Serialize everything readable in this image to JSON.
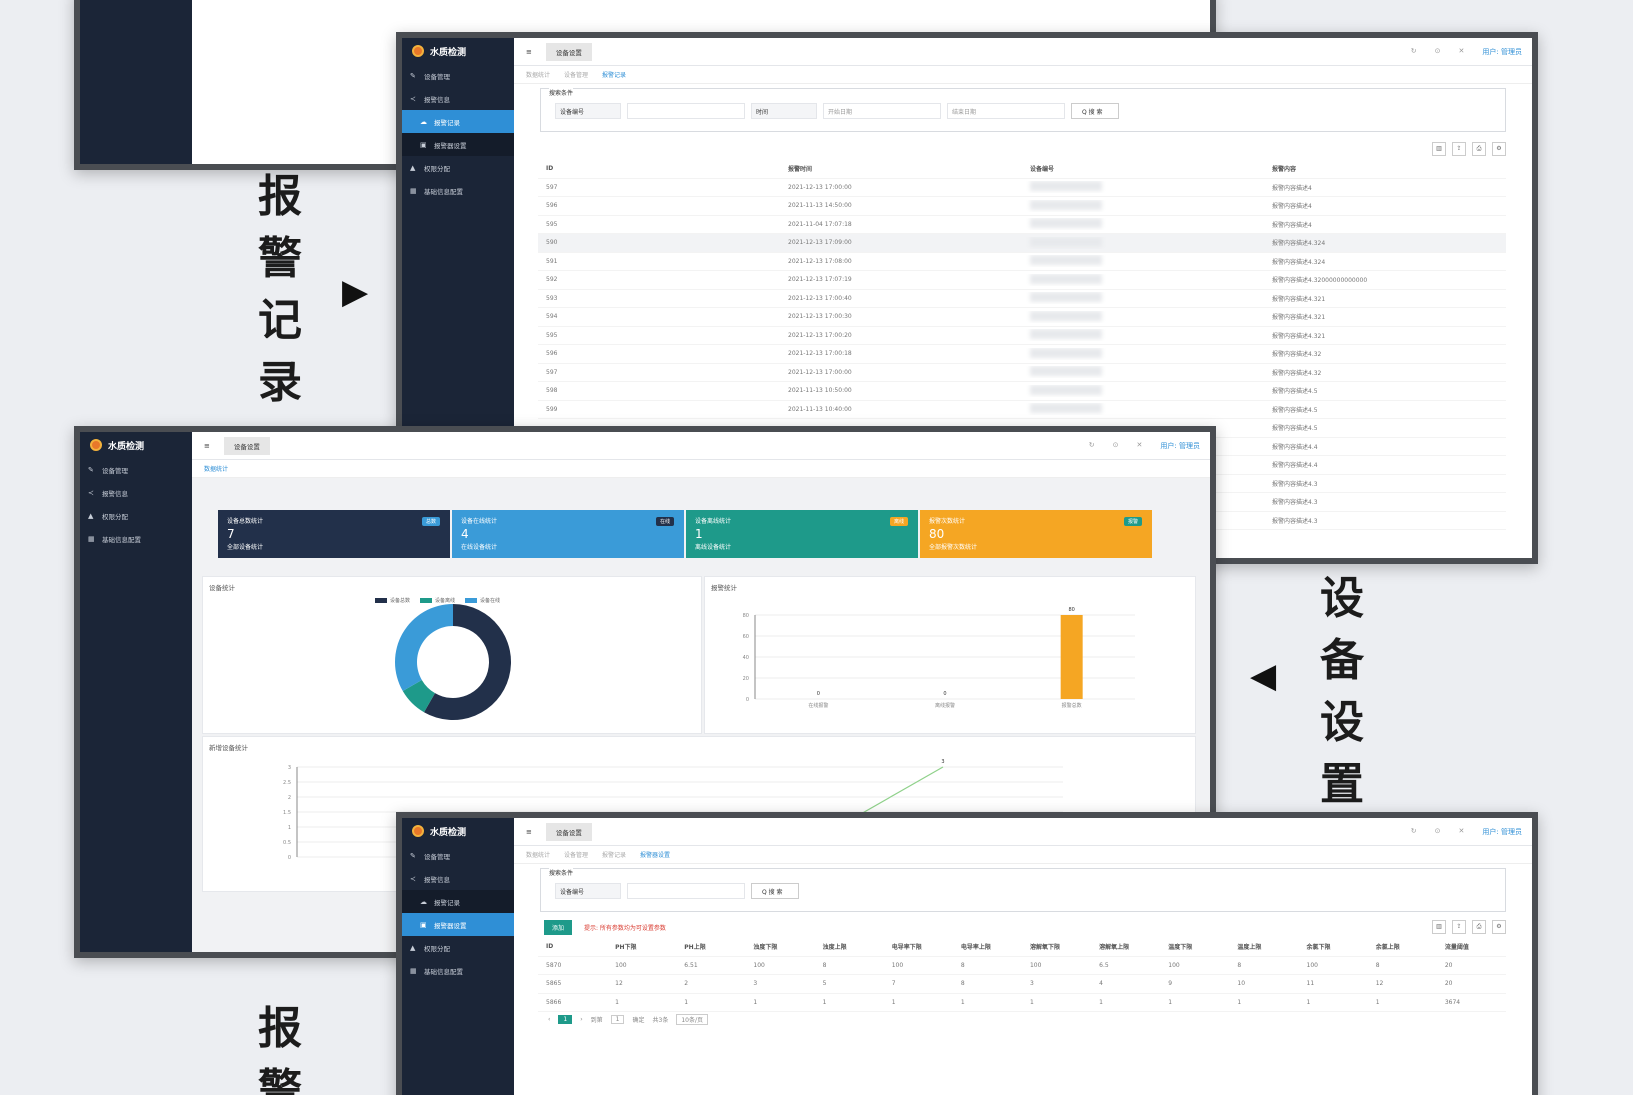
{
  "captions": {
    "alarm_record": [
      "报",
      "警",
      "记",
      "录"
    ],
    "device_settings": [
      "设",
      "备",
      "设",
      "置"
    ],
    "alarm_bottom": [
      "报",
      "警"
    ]
  },
  "app": {
    "title": "水质检测",
    "nav": [
      "设备管理",
      "报警信息",
      "报警记录",
      "报警器设置",
      "权限分配",
      "基础信息配置"
    ],
    "tab_home": "≡",
    "tab_active": "设备设置",
    "user": "用户: 管理员",
    "window_icons": [
      "↻",
      "⊙",
      "✕",
      "⋮"
    ]
  },
  "alarm_window": {
    "breadcrumbs": [
      "数据统计",
      "设备管理",
      "报警记录"
    ],
    "filter_title": "搜索条件",
    "filter_device_label": "设备编号",
    "filter_time_label": "时间",
    "filter_start": "开始日期",
    "filter_end": "结束日期",
    "search_button": "Q 搜 索",
    "columns": [
      "ID",
      "报警时间",
      "设备编号",
      "报警内容"
    ],
    "rows": [
      [
        "597",
        "2021-12-13 17:00:00",
        "",
        "报警内容描述4"
      ],
      [
        "596",
        "2021-11-13 14:50:00",
        "",
        "报警内容描述4"
      ],
      [
        "595",
        "2021-11-04 17:07:18",
        "",
        "报警内容描述4"
      ],
      [
        "590",
        "2021-12-13 17:09:00",
        "",
        "报警内容描述4.324"
      ],
      [
        "591",
        "2021-12-13 17:08:00",
        "",
        "报警内容描述4.324"
      ],
      [
        "592",
        "2021-12-13 17:07:19",
        "",
        "报警内容描述4.32000000000000"
      ],
      [
        "593",
        "2021-12-13 17:00:40",
        "",
        "报警内容描述4.321"
      ],
      [
        "594",
        "2021-12-13 17:00:30",
        "",
        "报警内容描述4.321"
      ],
      [
        "595",
        "2021-12-13 17:00:20",
        "",
        "报警内容描述4.321"
      ],
      [
        "596",
        "2021-12-13 17:00:18",
        "",
        "报警内容描述4.32"
      ],
      [
        "597",
        "2021-12-13 17:00:00",
        "",
        "报警内容描述4.32"
      ],
      [
        "598",
        "2021-11-13 10:50:00",
        "",
        "报警内容描述4.5"
      ],
      [
        "599",
        "2021-11-13 10:40:00",
        "",
        "报警内容描述4.5"
      ]
    ],
    "extra_contents": [
      "报警内容描述4.5",
      "报警内容描述4.4",
      "报警内容描述4.4",
      "报警内容描述4.3",
      "报警内容描述4.3",
      "报警内容描述4.3"
    ]
  },
  "dashboard": {
    "breadcrumbs": [
      "数据统计"
    ],
    "cards": [
      {
        "title": "设备总数统计",
        "value": "7",
        "sub": "全部设备统计",
        "badge": "总数",
        "color": "#22304a"
      },
      {
        "title": "设备在线统计",
        "value": "4",
        "sub": "在线设备统计",
        "badge": "在线",
        "color": "#3a9bd8"
      },
      {
        "title": "设备离线统计",
        "value": "1",
        "sub": "离线设备统计",
        "badge": "离线",
        "color": "#1e9a8a"
      },
      {
        "title": "报警次数统计",
        "value": "80",
        "sub": "全部报警次数统计",
        "badge": "报警",
        "color": "#f5a623"
      }
    ],
    "pie_title": "设备统计",
    "pie_legend": [
      "设备总数",
      "设备离线",
      "设备在线"
    ],
    "bar_title": "报警统计",
    "line_title": "新增设备统计"
  },
  "settings_window": {
    "breadcrumbs": [
      "数据统计",
      "设备管理",
      "报警记录",
      "报警器设置"
    ],
    "filter_title": "搜索条件",
    "filter_device_label": "设备编号",
    "search_button": "Q 搜 索",
    "add_button": "添加",
    "note": "提示: 所有参数均为可设置参数",
    "columns": [
      "ID",
      "PH下限",
      "PH上限",
      "浊度下限",
      "浊度上限",
      "电导率下限",
      "电导率上限",
      "溶解氧下限",
      "溶解氧上限",
      "温度下限",
      "温度上限",
      "余氯下限",
      "余氯上限",
      "流量阈值"
    ],
    "rows": [
      [
        "5870",
        "100",
        "6.51",
        "100",
        "8",
        "100",
        "8",
        "100",
        "6.5",
        "100",
        "8",
        "100",
        "8",
        "20"
      ],
      [
        "5865",
        "12",
        "2",
        "3",
        "5",
        "7",
        "8",
        "3",
        "4",
        "9",
        "10",
        "11",
        "12",
        "20"
      ],
      [
        "5866",
        "1",
        "1",
        "1",
        "1",
        "1",
        "1",
        "1",
        "1",
        "1",
        "1",
        "1",
        "1",
        "3674"
      ]
    ],
    "pager": {
      "current": "1",
      "goto": "到第",
      "page": "1",
      "confirm": "确定",
      "total": "共3条",
      "size": "10条/页"
    }
  },
  "chart_data": [
    {
      "type": "pie",
      "title": "设备统计",
      "categories": [
        "设备总数",
        "设备离线",
        "设备在线"
      ],
      "values": [
        7,
        1,
        4
      ]
    },
    {
      "type": "bar",
      "title": "报警统计",
      "categories": [
        "在线报警",
        "离线报警",
        "报警总数"
      ],
      "values": [
        0,
        0,
        80
      ],
      "ylim": [
        0,
        80
      ],
      "yticks": [
        "0",
        "20",
        "40",
        "60",
        "80"
      ],
      "data_labels": [
        "0",
        "0",
        "80"
      ]
    },
    {
      "type": "line",
      "title": "新增设备统计",
      "yticks": [
        "0",
        "0.5",
        "1",
        "1.5",
        "2",
        "2.5",
        "3"
      ],
      "peak_label": "3"
    }
  ]
}
